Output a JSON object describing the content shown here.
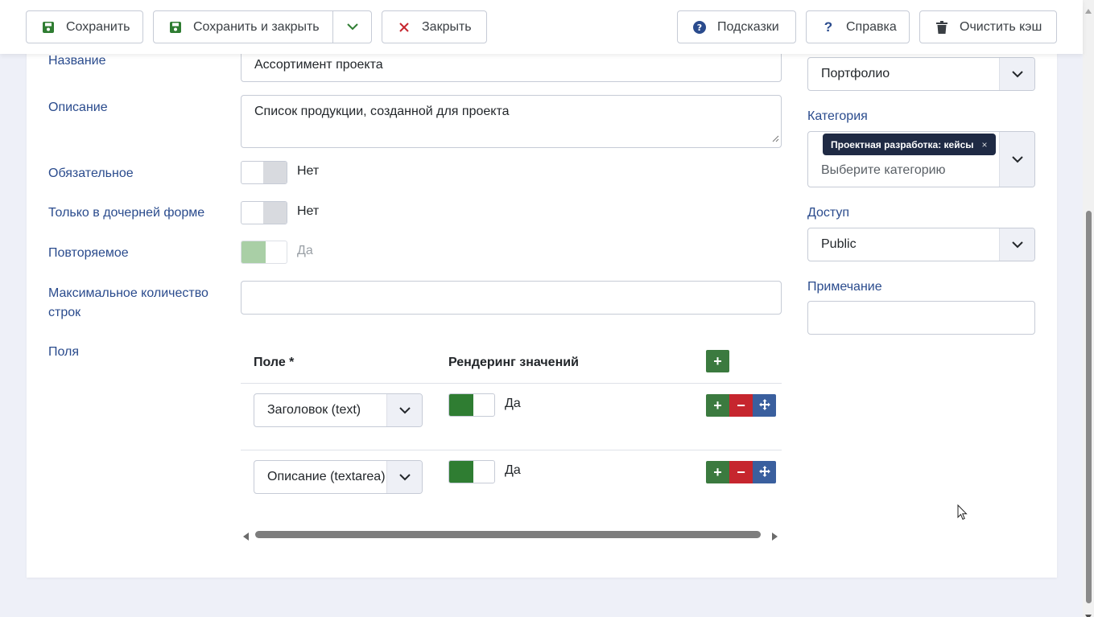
{
  "toolbar": {
    "save": "Сохранить",
    "save_close": "Сохранить и закрыть",
    "close": "Закрыть",
    "tips": "Подсказки",
    "help": "Справка",
    "clear_cache": "Очистить кэш"
  },
  "form": {
    "title_label": "Название",
    "title_value": "Ассортимент проекта",
    "description_label": "Описание",
    "description_value": "Список продукции, созданной для проекта",
    "required_label": "Обязательное",
    "required_value": "Нет",
    "subform_only_label": "Только в дочерней форме",
    "subform_only_value": "Нет",
    "repeatable_label": "Повторяемое",
    "repeatable_value": "Да",
    "max_rows_label_1": "Максимальное количество",
    "max_rows_label_2": "строк",
    "max_rows_value": "",
    "fields_label": "Поля"
  },
  "fields_table": {
    "col_field": "Поле *",
    "col_render": "Рендеринг значений",
    "rows": [
      {
        "field": "Заголовок (text)",
        "render": "Да"
      },
      {
        "field": "Описание (textarea)",
        "render": "Да"
      }
    ]
  },
  "sidebar": {
    "context_value": "Портфолио",
    "category_label": "Категория",
    "category_tag": "Проектная разработка: кейсы",
    "category_tag_remove": "×",
    "category_placeholder": "Выберите категорию",
    "access_label": "Доступ",
    "access_value": "Public",
    "note_label": "Примечание",
    "note_value": ""
  },
  "colors": {
    "accent_green": "#2f7d32",
    "remove_red": "#c6262e",
    "move_blue": "#3a5f9e",
    "label_blue": "#2a4b8d"
  }
}
